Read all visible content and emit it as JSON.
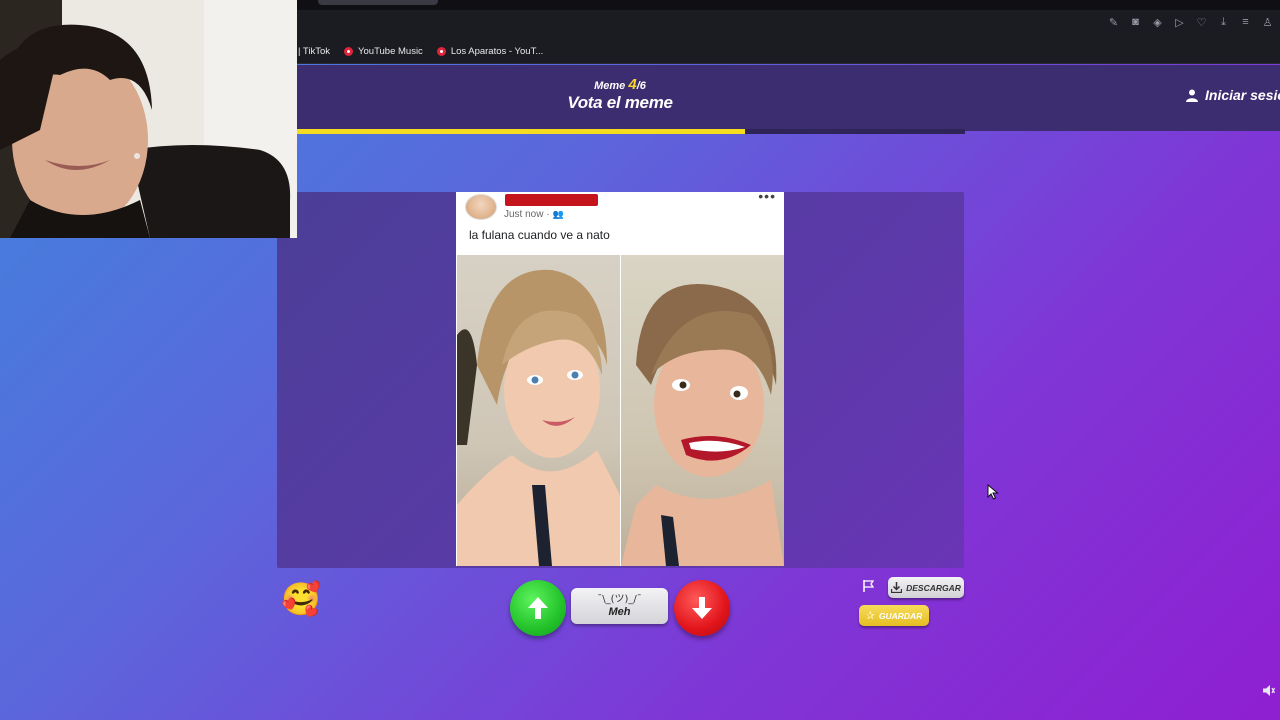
{
  "browser": {
    "bookmarks": [
      {
        "label": "| TikTok",
        "icon": "none"
      },
      {
        "label": "YouTube Music",
        "icon": "youtube-music-icon"
      },
      {
        "label": "Los Aparatos - YouT...",
        "icon": "youtube-music-icon"
      }
    ],
    "toolbar_icons": [
      "edit-icon",
      "camera-icon",
      "shield-icon",
      "play-icon",
      "heart-icon",
      "download-icon",
      "menu-icon",
      "profile-icon"
    ]
  },
  "header": {
    "meme_label": "Meme",
    "meme_current": "4",
    "meme_total": "/6",
    "title": "Vota el meme",
    "login_label": "Iniciar sesión",
    "progress": 0.67
  },
  "post": {
    "time": "Just now ·",
    "caption": "la fulana cuando ve a nato",
    "options": "•••"
  },
  "controls": {
    "emoji": "🥰",
    "meh_shrug": "¯\\_(ツ)_/¯",
    "meh_label": "Meh",
    "download_label": "DESCARGAR",
    "save_label": "GUARDAR"
  },
  "colors": {
    "accent_yellow": "#f5dc1f",
    "upvote_green": "#23c22a",
    "downvote_red": "#e1141b",
    "header_bg": "#3c2c70"
  }
}
